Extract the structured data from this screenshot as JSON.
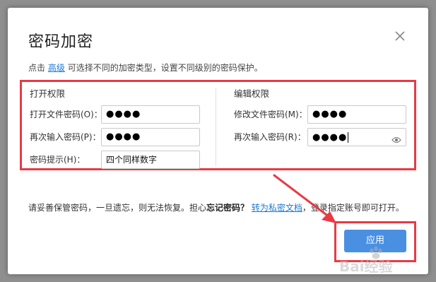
{
  "dialog": {
    "title": "密码加密",
    "close_icon": "close-icon"
  },
  "hint": {
    "prefix": "点击",
    "link": "高级",
    "suffix": "可选择不同的加密类型，设置不同级别的密码保护。"
  },
  "open_permission": {
    "title": "打开权限",
    "password_label": "打开文件密码(O)：",
    "password_value": "●●●●",
    "confirm_label": "再次输入密码(P)：",
    "confirm_value": "●●●●",
    "hint_label": "密码提示(H)：",
    "hint_value": "四个同样数字"
  },
  "edit_permission": {
    "title": "编辑权限",
    "password_label": "修改文件密码(M)：",
    "password_value": "●●●●",
    "confirm_label": "再次输入密码(R)：",
    "confirm_value": "●●●●",
    "reveal_icon": "eye-icon"
  },
  "footer": {
    "warning_plain": "请妥善保管密码，一旦遗忘，则无法恢复。担心",
    "warning_bold": "忘记密码？",
    "warning_link": "转为私密文档",
    "warning_tail": "，登录指定账号即可打开。",
    "ok_label": "应用"
  },
  "colors": {
    "accent": "#4a90e2",
    "highlight": "#e83a45",
    "link": "#1a7ad3"
  },
  "watermark": {
    "text": "Bai经验",
    "icon": "baidu-paw-icon"
  }
}
